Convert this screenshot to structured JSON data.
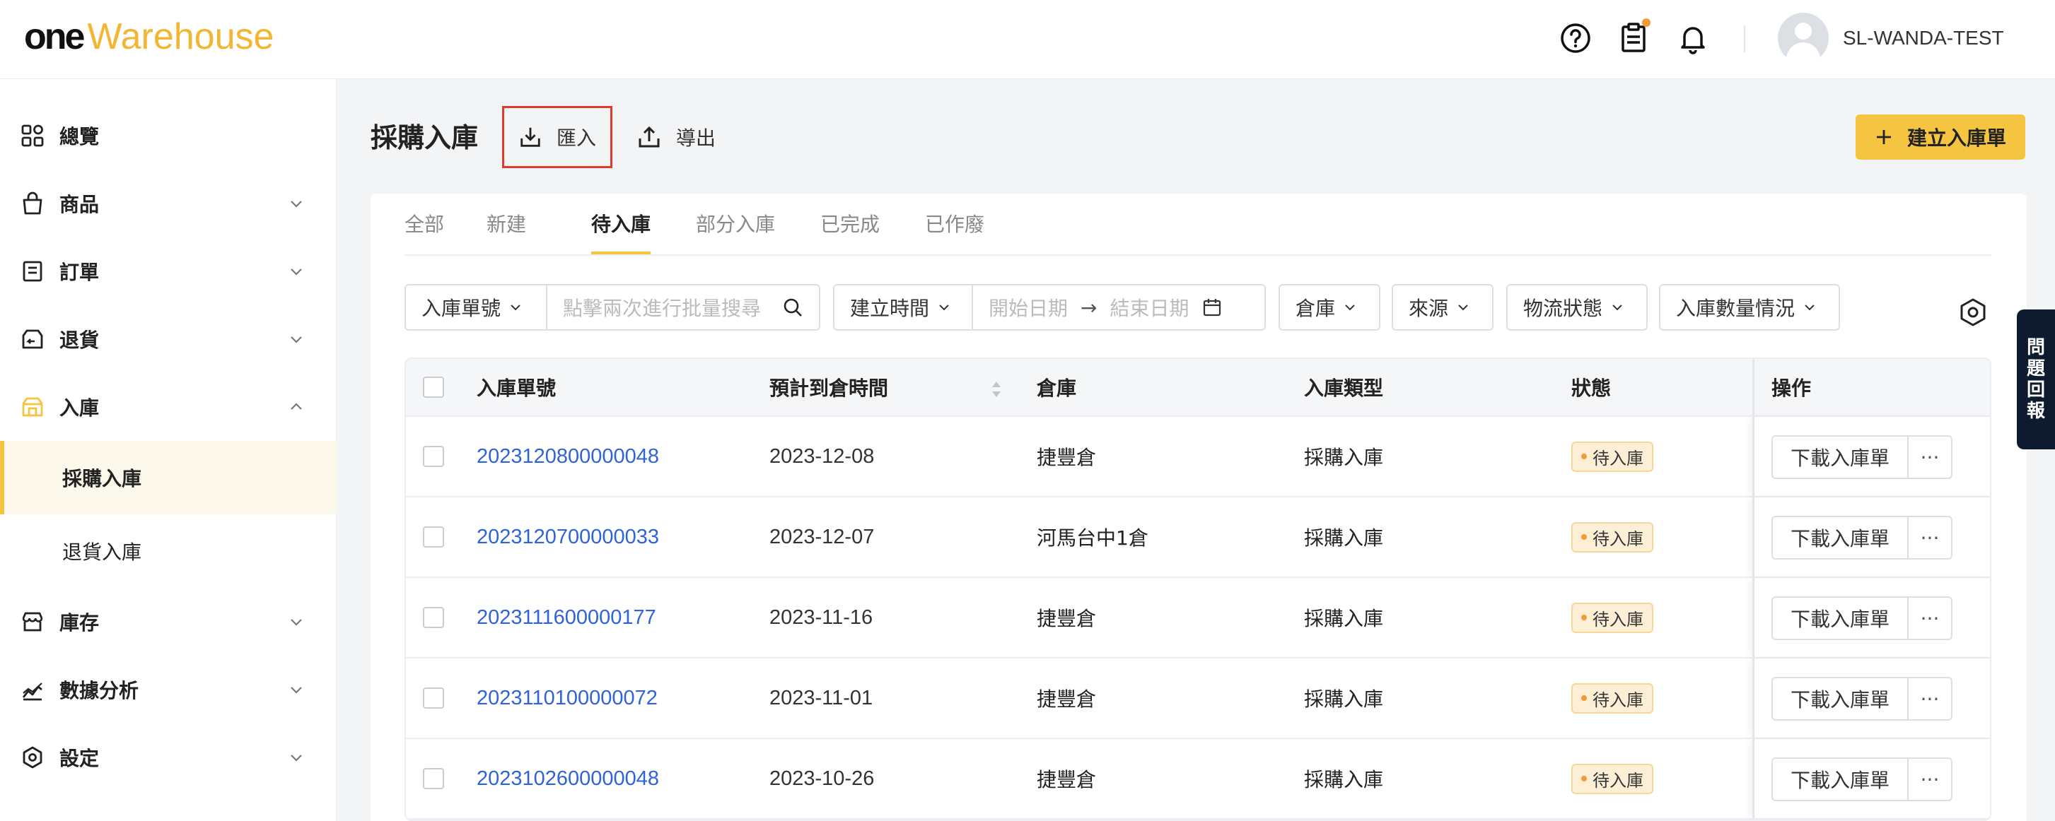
{
  "header": {
    "logo_one": "one",
    "logo_warehouse": "Warehouse",
    "username": "SL-WANDA-TEST",
    "icons": [
      "help-icon",
      "clipboard-icon",
      "bell-icon"
    ]
  },
  "sidebar": {
    "items": [
      {
        "label": "總覽",
        "icon": "overview-icon"
      },
      {
        "label": "商品",
        "icon": "bag-icon"
      },
      {
        "label": "訂單",
        "icon": "order-icon"
      },
      {
        "label": "退貨",
        "icon": "return-icon"
      },
      {
        "label": "入庫",
        "icon": "inbound-icon"
      },
      {
        "label": "庫存",
        "icon": "store-icon"
      },
      {
        "label": "數據分析",
        "icon": "analytics-icon"
      },
      {
        "label": "設定",
        "icon": "settings-icon"
      }
    ],
    "sub_items": [
      {
        "label": "採購入庫"
      },
      {
        "label": "退貨入庫"
      }
    ]
  },
  "page": {
    "title": "採購入庫",
    "import_label": "匯入",
    "export_label": "導出",
    "create_label": "建立入庫單"
  },
  "tabs": [
    "全部",
    "新建",
    "待入庫",
    "部分入庫",
    "已完成",
    "已作廢"
  ],
  "filters": {
    "order_no": "入庫單號",
    "search_placeholder": "點擊兩次進行批量搜尋",
    "created_time": "建立時間",
    "start_date": "開始日期",
    "arrow": "→",
    "end_date": "結束日期",
    "warehouse": "倉庫",
    "source": "來源",
    "logistics_status": "物流狀態",
    "inbound_qty": "入庫數量情況"
  },
  "table": {
    "headers": {
      "order_no": "入庫單號",
      "eta": "預計到倉時間",
      "warehouse": "倉庫",
      "type": "入庫類型",
      "status": "狀態",
      "action": "操作"
    },
    "download_label": "下載入庫單",
    "more_label": "···",
    "rows": [
      {
        "order_no": "2023120800000048",
        "eta": "2023-12-08",
        "warehouse": "捷豐倉",
        "type": "採購入庫",
        "status": "待入庫"
      },
      {
        "order_no": "2023120700000033",
        "eta": "2023-12-07",
        "warehouse": "河馬台中1倉",
        "type": "採購入庫",
        "status": "待入庫"
      },
      {
        "order_no": "2023111600000177",
        "eta": "2023-11-16",
        "warehouse": "捷豐倉",
        "type": "採購入庫",
        "status": "待入庫"
      },
      {
        "order_no": "2023110100000072",
        "eta": "2023-11-01",
        "warehouse": "捷豐倉",
        "type": "採購入庫",
        "status": "待入庫"
      },
      {
        "order_no": "2023102600000048",
        "eta": "2023-10-26",
        "warehouse": "捷豐倉",
        "type": "採購入庫",
        "status": "待入庫"
      }
    ]
  },
  "feedback": {
    "label": "問題回報"
  },
  "colors": {
    "accent": "#f5c542",
    "link": "#2f63d9",
    "highlight_border": "#e03a2f",
    "badge_bg": "#fcefd6"
  }
}
